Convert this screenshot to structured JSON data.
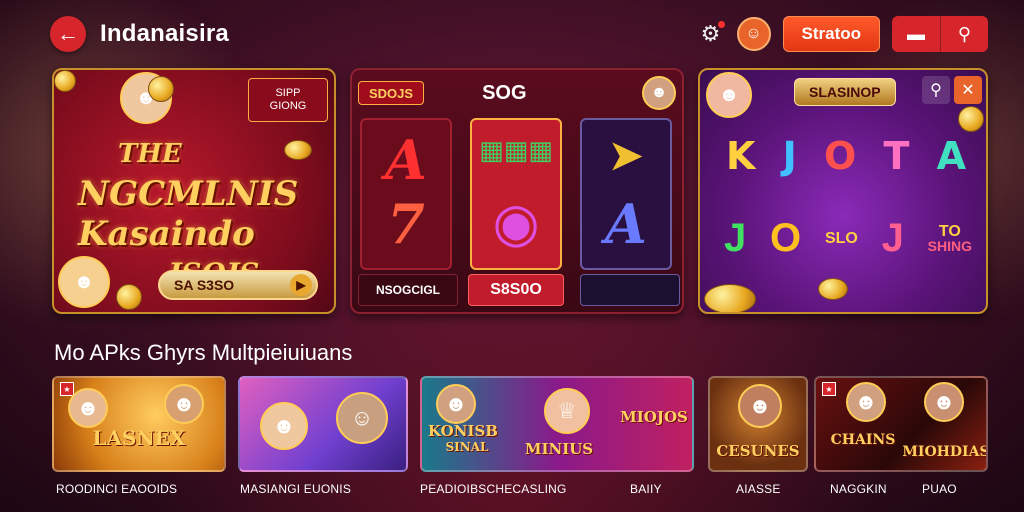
{
  "header": {
    "title": "Indanaisira",
    "back_icon": "back-arrow-icon",
    "settings_icon": "gear-icon",
    "avatar_icon": "avatar-icon",
    "primary_button": "Stratoo",
    "menu_icon": "menu-icon",
    "search_icon": "search-icon",
    "accent": "#d6262c"
  },
  "banners": [
    {
      "badge_line1": "SIPP",
      "badge_line2": "GIONG",
      "title_l1": "THE",
      "title_l2": "NGCMLNIS",
      "title_l3": "Kasaindo",
      "title_l4": "JSOJS",
      "pill_text": "SA  S3SO"
    },
    {
      "tag": "SDOJS",
      "title": "SOG",
      "button1": "NSOGCIGL",
      "button2": "S8S0O",
      "button3": ""
    },
    {
      "title": "SLASINOP",
      "row1": [
        "K",
        "J",
        "O",
        "T",
        "A"
      ],
      "row2_a": "J",
      "row2_b": "O",
      "row2_c": "SLO",
      "row2_d": "J",
      "row2_e_line1": "TO",
      "row2_e_line2": "SHING"
    }
  ],
  "section": {
    "title": "Mo APks Ghyrs Multpieiuiuans"
  },
  "games": [
    {
      "label": "LASNEX",
      "caption": "ROODINCI EAOOIDS"
    },
    {
      "label": "",
      "caption": "MASIANGI EUONIS"
    },
    {
      "label_a": "KONISB",
      "label_a2": "SINAL",
      "label_b": "MINIUS",
      "label_c": "MIOJOS",
      "caption": "PEADIOIBSCHECASLING"
    },
    {
      "label": "CESUNES",
      "caption_a": "BAIIY",
      "caption_b": "AIASSE"
    },
    {
      "label_a": "CHAINS",
      "label_b": "MIOHDIAS",
      "caption_a": "NAGGKIN",
      "caption_b": "PUAO"
    }
  ]
}
